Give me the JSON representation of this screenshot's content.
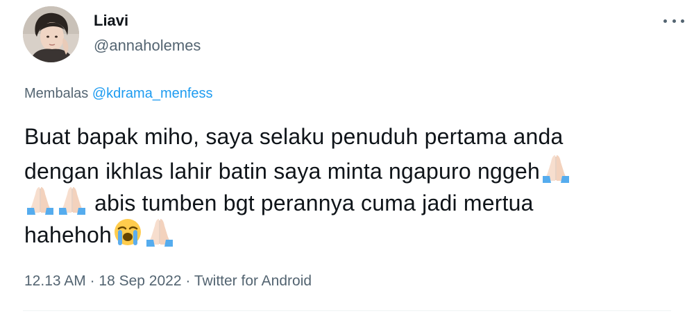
{
  "user": {
    "display_name": "Liavi",
    "handle": "@annaholemes",
    "avatar_icon": "profile-photo"
  },
  "reply": {
    "prefix": "Membalas",
    "mention": "@kdrama_menfess",
    "mention_color": "#1d9bf0"
  },
  "tweet": {
    "line1": "Buat bapak miho, saya selaku penuduh pertama anda",
    "line2": "dengan ikhlas lahir batin saya minta ngapuro nggeh",
    "line3": " abis tumben bgt perannya cuma jadi mertua",
    "line4": "hahehoh",
    "emojis": [
      "folded-hands-emoji",
      "crying-face-emoji"
    ]
  },
  "meta": {
    "time": "12.13 AM",
    "separator1": " · ",
    "date": "18 Sep 2022",
    "separator2": " · ",
    "source": "Twitter for Android"
  },
  "more_icon": "more-horizontal-icon"
}
